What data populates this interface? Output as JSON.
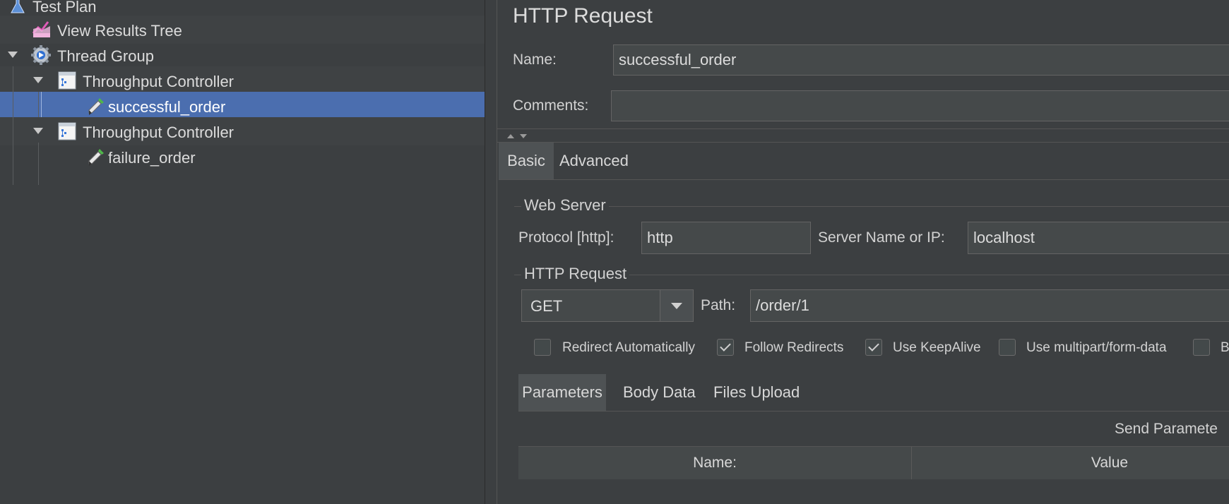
{
  "tree": {
    "items": [
      {
        "label": "Test Plan",
        "icon": "test-plan-icon"
      },
      {
        "label": "View Results Tree",
        "icon": "view-results-tree-icon"
      },
      {
        "label": "Thread Group",
        "icon": "thread-group-gear-icon"
      },
      {
        "label": "Throughput Controller",
        "icon": "throughput-controller-icon"
      },
      {
        "label": "successful_order",
        "icon": "http-sampler-pipette-icon",
        "selected": true
      },
      {
        "label": "Throughput Controller",
        "icon": "throughput-controller-icon"
      },
      {
        "label": "failure_order",
        "icon": "http-sampler-pipette-icon"
      }
    ]
  },
  "panel": {
    "title": "HTTP Request",
    "name_label": "Name:",
    "name_value": "successful_order",
    "comments_label": "Comments:",
    "comments_value": "",
    "tabs": [
      {
        "label": "Basic",
        "active": true
      },
      {
        "label": "Advanced",
        "active": false
      }
    ],
    "web_server": {
      "title": "Web Server",
      "protocol_label": "Protocol [http]:",
      "protocol_value": "http",
      "server_label": "Server Name or IP:",
      "server_value": "localhost"
    },
    "http_request": {
      "title": "HTTP Request",
      "method": "GET",
      "path_label": "Path:",
      "path_value": "/order/1"
    },
    "checkboxes": [
      {
        "label": "Redirect Automatically",
        "checked": false
      },
      {
        "label": "Follow Redirects",
        "checked": true
      },
      {
        "label": "Use KeepAlive",
        "checked": true
      },
      {
        "label": "Use multipart/form-data",
        "checked": false
      },
      {
        "label": "B",
        "checked": false
      }
    ],
    "sub_tabs": [
      {
        "label": "Parameters",
        "active": true
      },
      {
        "label": "Body Data",
        "active": false
      },
      {
        "label": "Files Upload",
        "active": false
      }
    ],
    "send_params_label": "Send Paramete",
    "table_columns": [
      "Name:",
      "Value"
    ]
  }
}
